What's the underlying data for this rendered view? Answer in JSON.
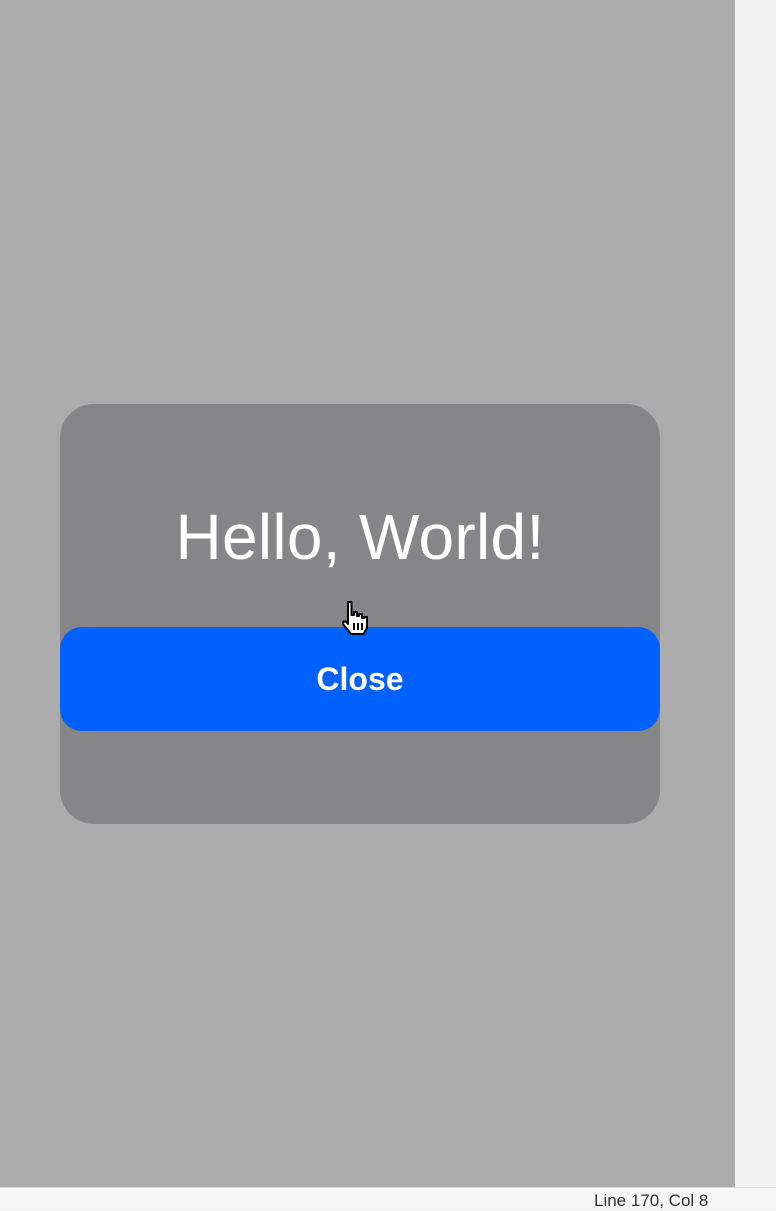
{
  "modal": {
    "title": "Hello, World!",
    "close_label": "Close"
  },
  "status_bar": {
    "text": "Line 170, Col 8"
  },
  "colors": {
    "overlay": "#acacac",
    "modal_background": "#868587",
    "button": "#0061fe",
    "text": "#ffffff"
  },
  "icons": {
    "cursor": "hand-pointer-icon"
  }
}
